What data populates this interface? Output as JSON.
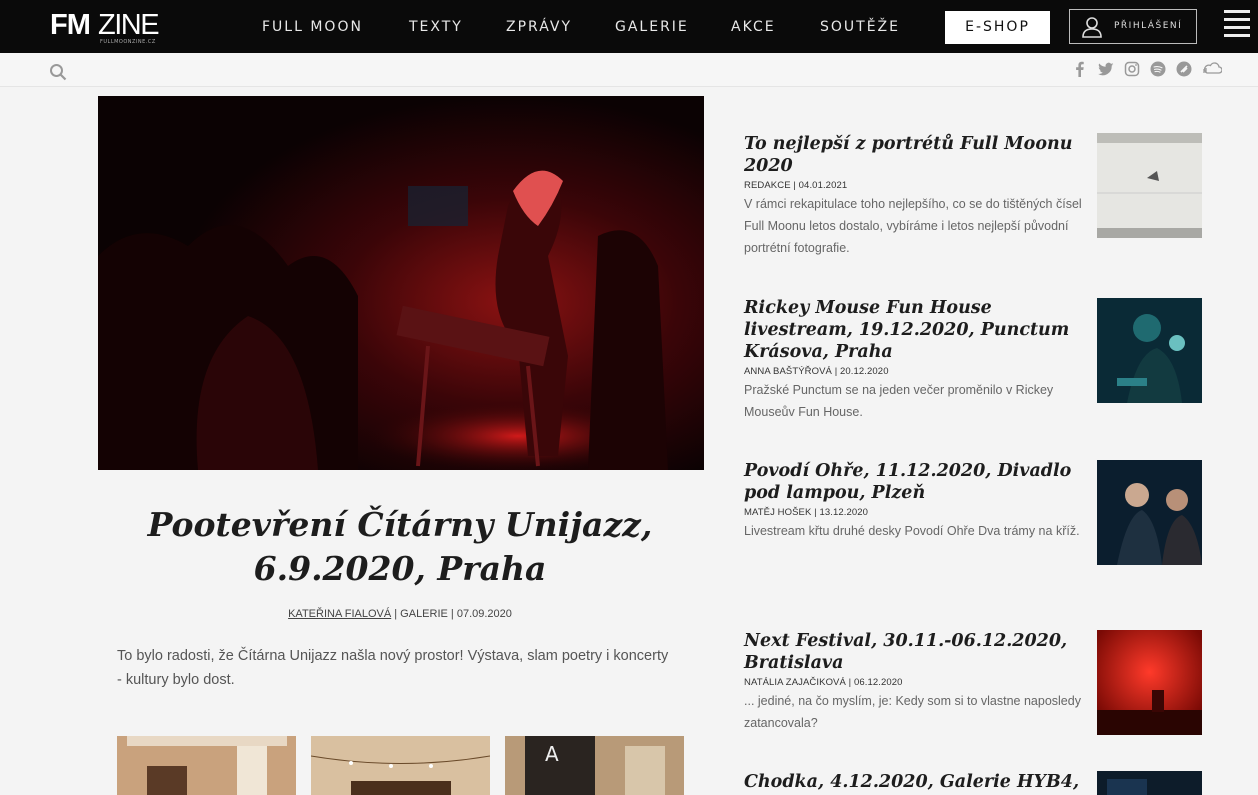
{
  "logo": {
    "fm": "FM",
    "zine": "ZINE",
    "sub": "FULLMOONZINE.CZ"
  },
  "nav": {
    "items": [
      "FULL MOON",
      "TEXTY",
      "ZPRÁVY",
      "GALERIE",
      "AKCE",
      "SOUTĚŽE"
    ],
    "eshop": "E-SHOP",
    "login": "PŘIHLÁŠENÍ"
  },
  "socials": [
    "facebook-icon",
    "twitter-icon",
    "instagram-icon",
    "spotify-icon",
    "bandzone-icon",
    "soundcloud-icon"
  ],
  "hero": {
    "title": "Pootevření Čítárny Unijazz, 6.9.2020, Praha",
    "author": "KATEŘINA FIALOVÁ",
    "meta_rest": " | GALERIE | 07.09.2020",
    "excerpt": "To bylo radosti, že Čítárna Unijazz našla nový prostor! Výstava, slam poetry i koncerty - kultury bylo dost."
  },
  "articles": [
    {
      "title": "To nejlepší z portrétů Full Moonu 2020",
      "meta": "REDAKCE | 04.01.2021",
      "excerpt": "V rámci rekapitulace toho nejlepšího, co se do tištěných čísel Full Moonu letos dostalo, vybíráme i letos nejlepší původní portrétní fotografie."
    },
    {
      "title": "Rickey Mouse Fun House livestream, 19.12.2020, Punctum Krásova, Praha",
      "meta": "ANNA BAŠTÝŘOVÁ | 20.12.2020",
      "excerpt": "Pražské Punctum se na jeden večer proměnilo v Rickey Mouseův Fun House."
    },
    {
      "title": "Povodí Ohře, 11.12.2020, Divadlo pod lampou, Plzeň",
      "meta": "MATĚJ HOŠEK | 13.12.2020",
      "excerpt": "Livestream křtu druhé desky Povodí Ohře Dva trámy na kříž."
    },
    {
      "title": "Next Festival, 30.11.-06.12.2020, Bratislava",
      "meta": "NATÁLIA ZAJAČIKOVÁ | 06.12.2020",
      "excerpt": "... jediné, na čo myslím, je: Kedy som si to vlastne naposledy zatancovala?"
    },
    {
      "title": "Chodka, 4.12.2020, Galerie HYB4,",
      "meta": "",
      "excerpt": ""
    }
  ]
}
